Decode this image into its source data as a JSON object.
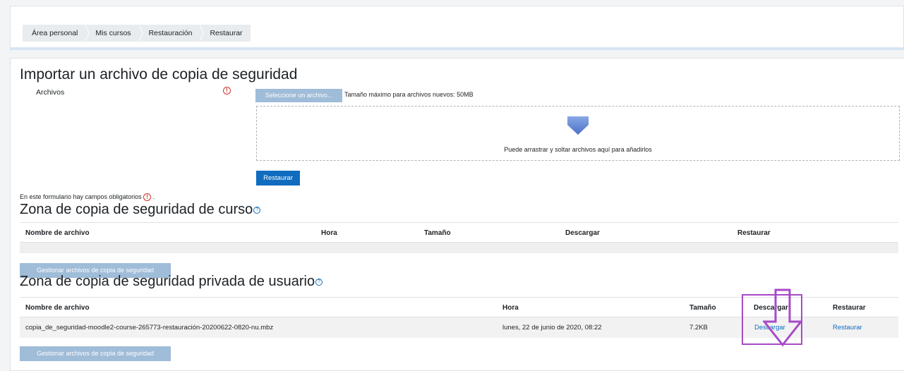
{
  "breadcrumb": [
    "Área personal",
    "Mis cursos",
    "Restauración",
    "Restaurar"
  ],
  "import": {
    "title": "Importar un archivo de copia de seguridad",
    "field_label": "Archivos",
    "choose_button": "Seleccione un archivo...",
    "max_size": "Tamaño máximo para archivos nuevos: 50MB",
    "drop_text": "Puede arrastrar y soltar archivos aquí para añadirlos",
    "restore_button": "Restaurar"
  },
  "required_note": "En este formulario hay campos obligatorios",
  "required_note_suffix": ".",
  "course_zone": {
    "title": "Zona de copia de seguridad de curso",
    "columns": [
      "Nombre de archivo",
      "Hora",
      "Tamaño",
      "Descargar",
      "Restaurar"
    ],
    "manage_button": "Gestionar archivos de copia de seguridad"
  },
  "user_zone": {
    "title": "Zona de copia de seguridad privada de usuario",
    "columns": [
      "Nombre de archivo",
      "Hora",
      "Tamaño",
      "Descargar",
      "Restaurar"
    ],
    "rows": [
      {
        "filename": "copia_de_seguridad-moodle2-course-265773-restauración-20200622-0820-nu.mbz",
        "time": "lunes, 22 de junio de 2020, 08:22",
        "size": "7.2KB",
        "download": "Descargar",
        "restore": "Restaurar"
      }
    ],
    "manage_button": "Gestionar archivos de copia de seguridad"
  },
  "icons": {
    "required": "exclamation-circle-icon",
    "help": "question-circle-icon",
    "dropzone": "arrow-down-icon"
  },
  "colors": {
    "primary": "#0f6cbf",
    "disabled_button": "#9fbcd8",
    "required": "#ca3120",
    "annotation": "#a84ac7"
  }
}
